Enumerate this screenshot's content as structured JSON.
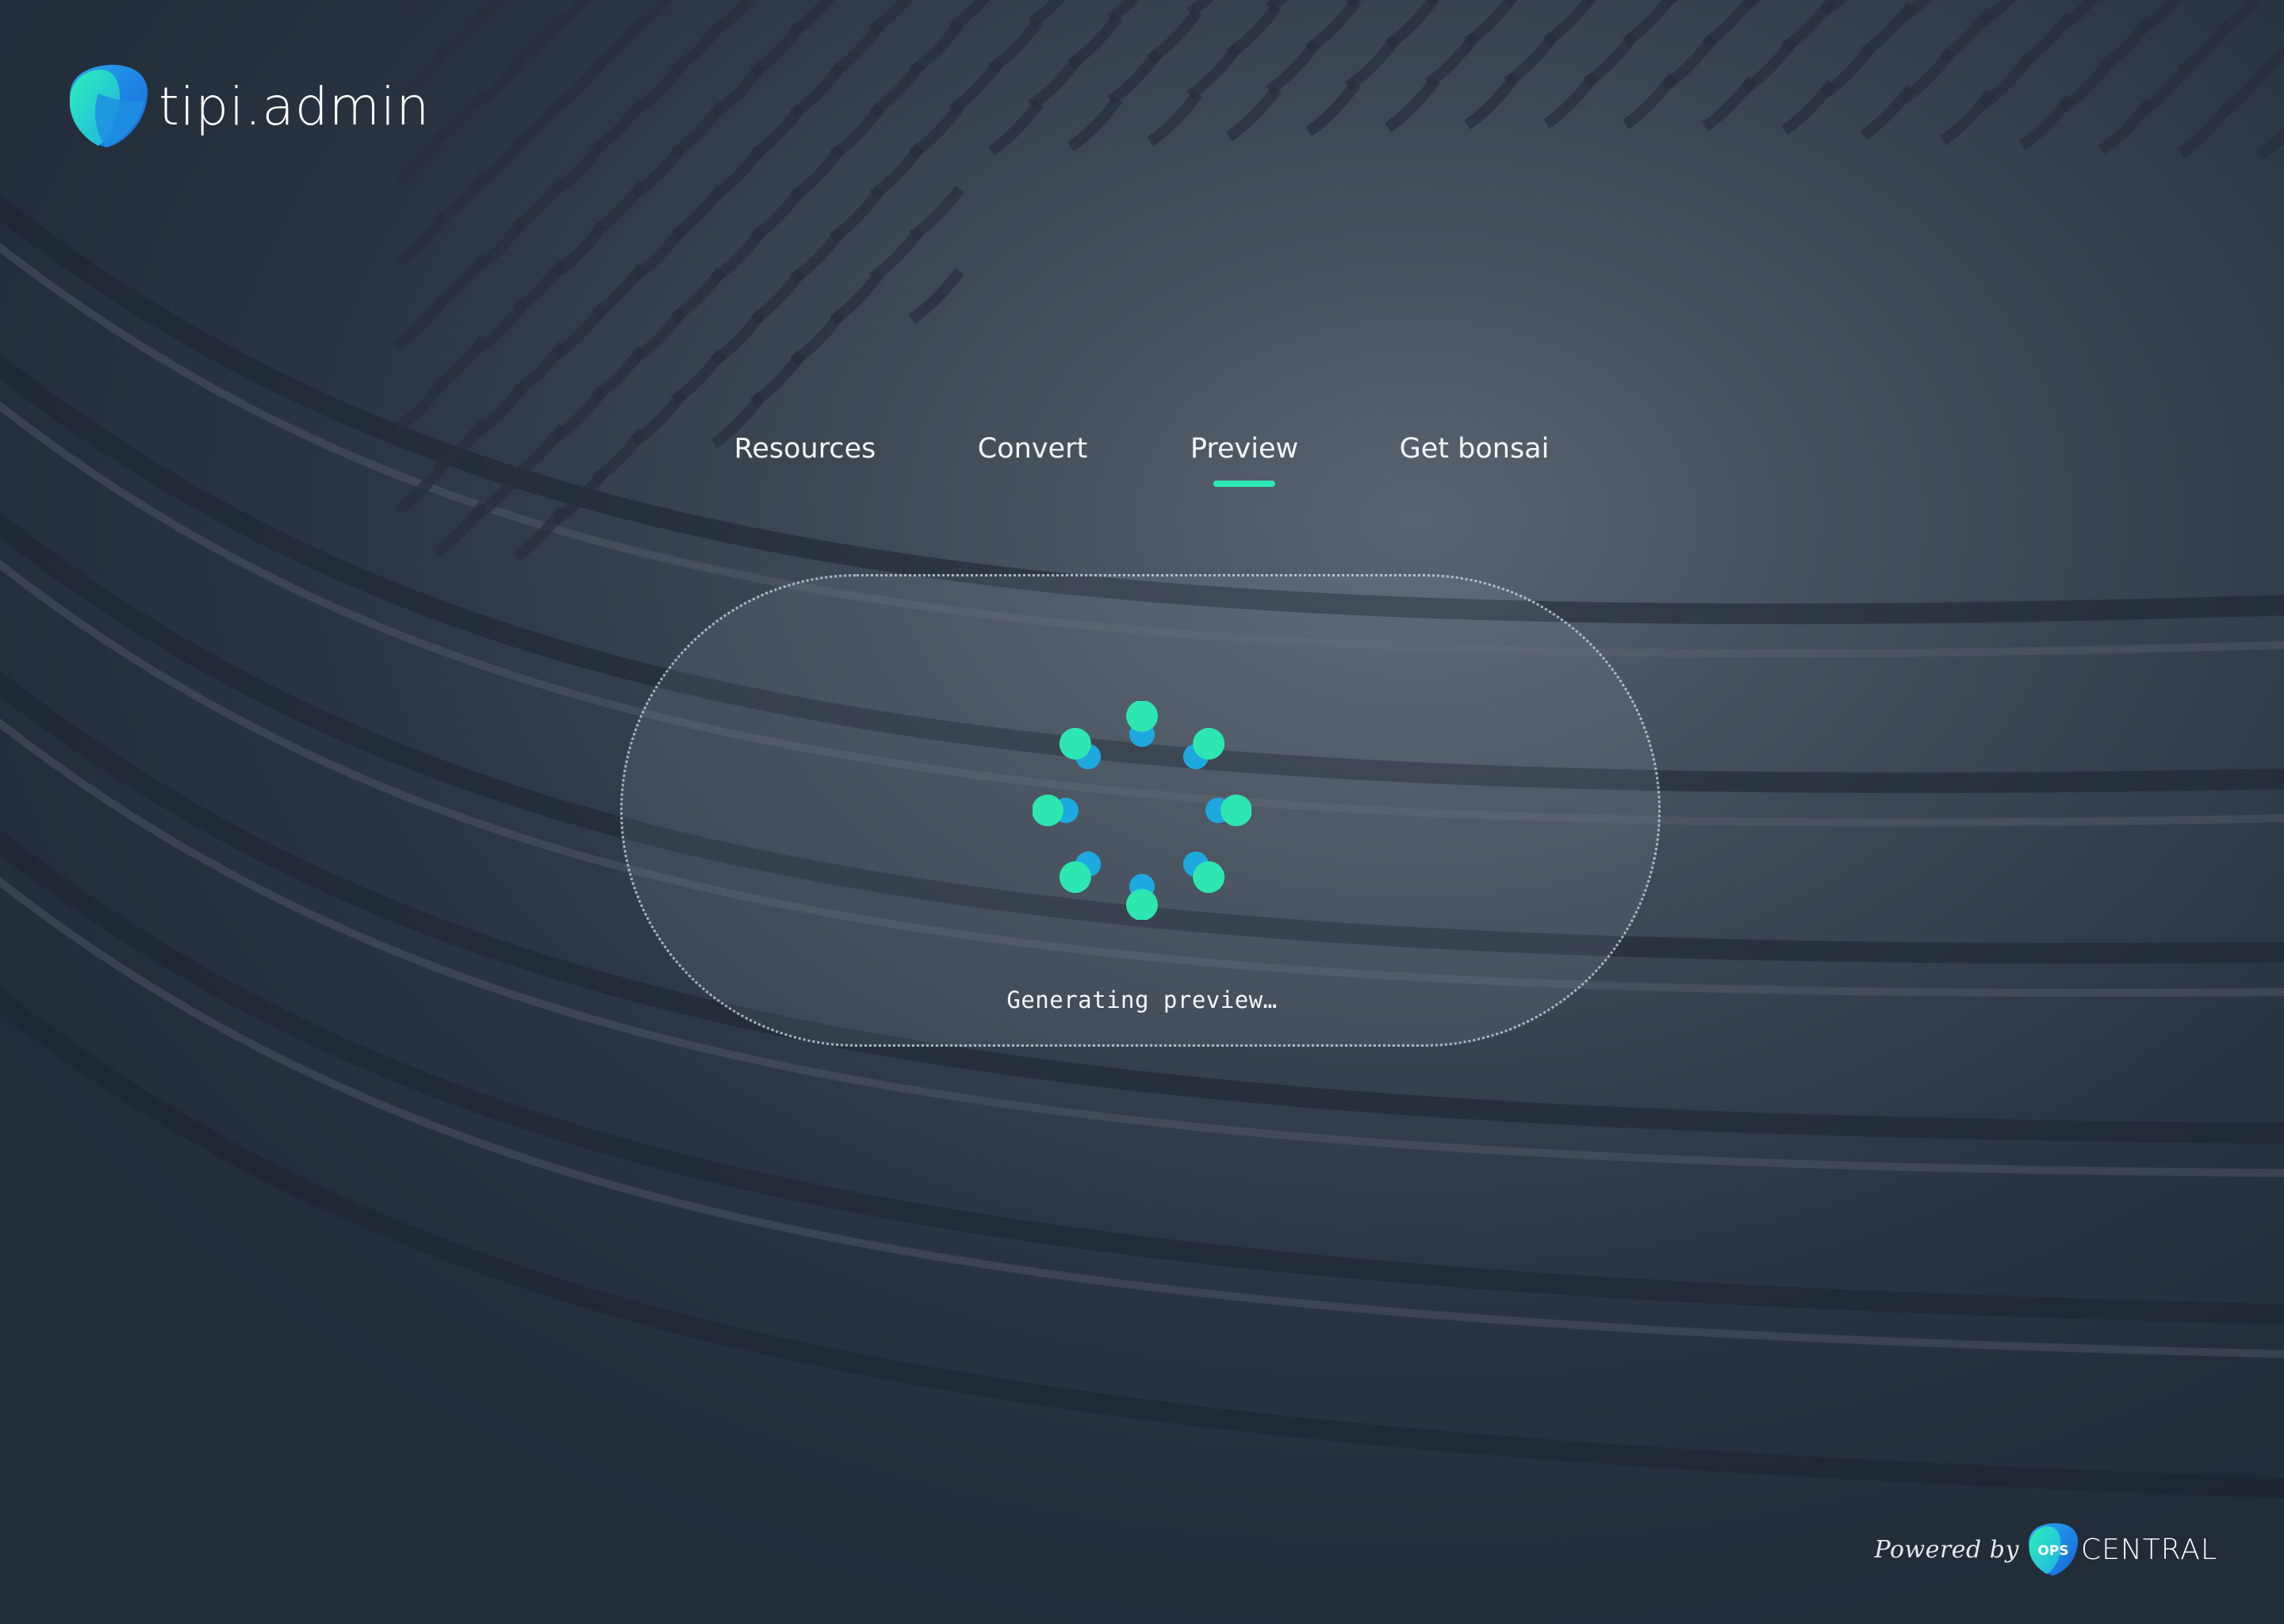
{
  "app": {
    "name": "tipi.admin"
  },
  "nav": {
    "items": [
      {
        "label": "Resources",
        "active": false
      },
      {
        "label": "Convert",
        "active": false
      },
      {
        "label": "Preview",
        "active": true
      },
      {
        "label": "Get bonsai",
        "active": false
      }
    ]
  },
  "preview": {
    "status": "Generating preview…"
  },
  "footer": {
    "powered_by": "Powered by",
    "brand_badge": "OPS",
    "brand_name": "CENTRAL"
  },
  "colors": {
    "accent": "#2ee6b0",
    "accent_secondary": "#1ea8e0",
    "background": "#232d38"
  },
  "icons": {
    "logo": "tipi-logo-icon",
    "spinner": "loading-spinner-icon",
    "footer_logo": "ops-central-logo-icon"
  }
}
